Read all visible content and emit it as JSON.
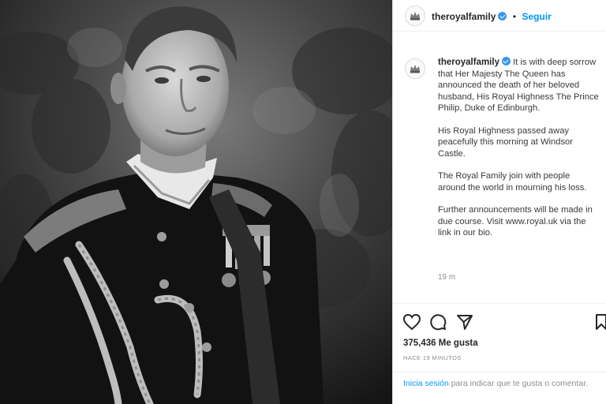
{
  "post": {
    "username": "theroyalfamily",
    "follow_label": "Seguir",
    "separator": "•",
    "caption_paragraphs": [
      "It is with deep sorrow that Her Majesty The Queen has announced the death of her beloved husband, His Royal Highness The Prince Philip, Duke of Edinburgh.",
      "His Royal Highness passed away peacefully this morning at Windsor Castle.",
      "The Royal Family join with people around the world in mourning his loss.",
      "Further announcements will be made in due course. Visit www.royal.uk via the link in our bio."
    ],
    "caption_time": "19 m",
    "likes": "375,436 Me gusta",
    "posted_ago": "HACE 19 MINUTOS"
  },
  "login_prompt": {
    "link": "Inicia sesión",
    "text": " para indicar que te gusta o comentar."
  },
  "icons": {
    "like": "heart-icon",
    "comment": "comment-icon",
    "share": "share-icon",
    "save": "bookmark-icon",
    "verified": "verified-badge-icon",
    "avatar": "royal-crest-icon"
  },
  "colors": {
    "link_blue": "#0095f6",
    "verified_blue": "#3897f0",
    "text": "#262626",
    "muted": "#8e8e8e"
  }
}
